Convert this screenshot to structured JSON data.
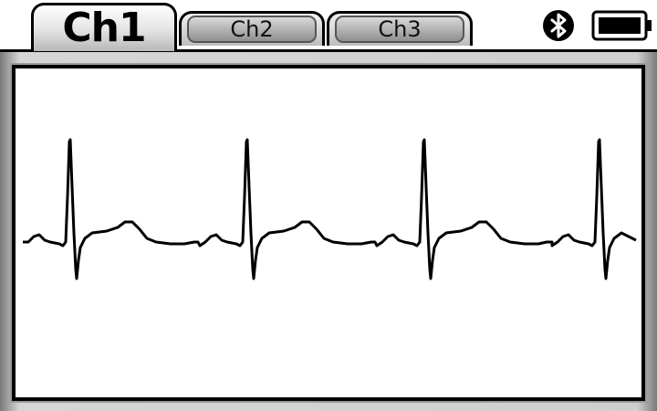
{
  "tabs": [
    {
      "label": "Ch1",
      "active": true
    },
    {
      "label": "Ch2",
      "active": false
    },
    {
      "label": "Ch3",
      "active": false
    }
  ],
  "status_icons": {
    "bluetooth": "bluetooth-icon",
    "battery": "battery-icon",
    "battery_level": 1.0
  },
  "waveform": {
    "beat_count": 4,
    "color": "#000000",
    "background": "#ffffff"
  }
}
